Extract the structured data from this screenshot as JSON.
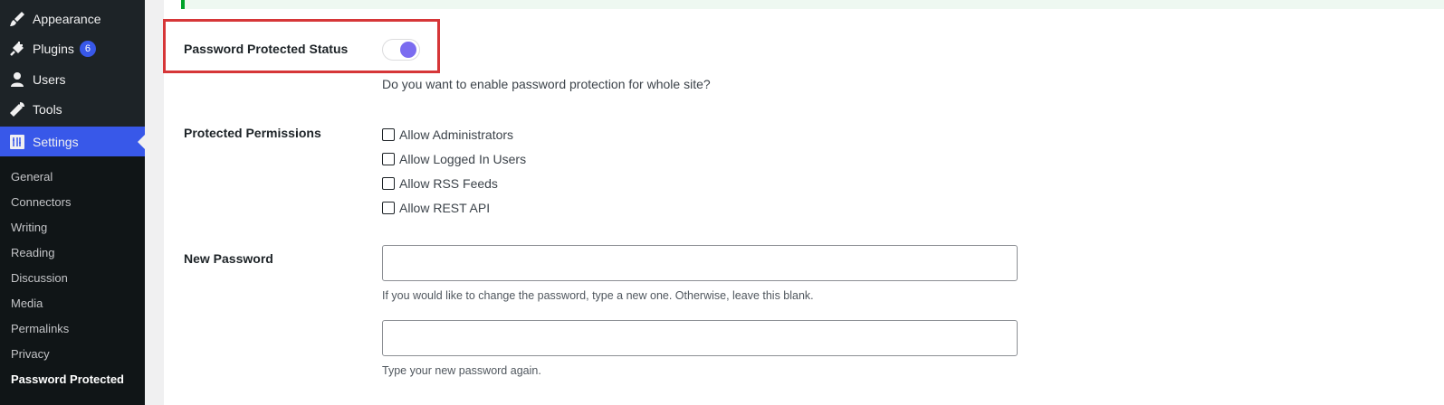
{
  "sidebar": {
    "menu": [
      {
        "label": "Appearance",
        "icon": "paintbrush-icon"
      },
      {
        "label": "Plugins",
        "icon": "plugin-icon",
        "badge": "6"
      },
      {
        "label": "Users",
        "icon": "user-icon"
      },
      {
        "label": "Tools",
        "icon": "wrench-icon"
      },
      {
        "label": "Settings",
        "icon": "settings-icon",
        "current": true
      }
    ],
    "submenu": [
      {
        "label": "General"
      },
      {
        "label": "Connectors"
      },
      {
        "label": "Writing"
      },
      {
        "label": "Reading"
      },
      {
        "label": "Discussion"
      },
      {
        "label": "Media"
      },
      {
        "label": "Permalinks"
      },
      {
        "label": "Privacy"
      },
      {
        "label": "Password Protected",
        "active": true
      }
    ]
  },
  "settings": {
    "status": {
      "label": "Password Protected Status",
      "enabled": true,
      "description": "Do you want to enable password protection for whole site?"
    },
    "permissions": {
      "label": "Protected Permissions",
      "options": [
        {
          "label": "Allow Administrators",
          "checked": false
        },
        {
          "label": "Allow Logged In Users",
          "checked": false
        },
        {
          "label": "Allow RSS Feeds",
          "checked": false
        },
        {
          "label": "Allow REST API",
          "checked": false
        }
      ]
    },
    "new_password": {
      "label": "New Password",
      "value": "",
      "hint": "If you would like to change the password, type a new one. Otherwise, leave this blank.",
      "confirm_value": "",
      "confirm_hint": "Type your new password again."
    }
  },
  "colors": {
    "accent": "#3858e9",
    "toggle_knob": "#7b6cf0",
    "highlight": "#d63638",
    "notice": "#00a32a"
  }
}
